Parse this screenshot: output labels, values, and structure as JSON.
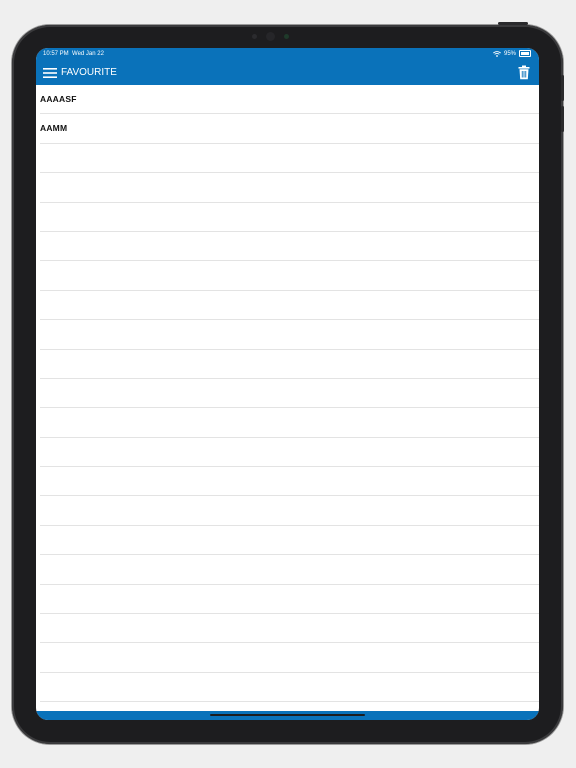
{
  "status_bar": {
    "time": "10:57 PM",
    "date": "Wed Jan 22",
    "wifi_icon": "wifi-icon",
    "battery_percent": "95%",
    "battery_level": 0.95
  },
  "nav": {
    "menu_icon": "hamburger-menu-icon",
    "title": "FAVOURITE",
    "delete_icon": "trash-icon"
  },
  "favourites": [
    {
      "label": "AAAASF"
    },
    {
      "label": "AAMM"
    },
    {
      "label": ""
    },
    {
      "label": ""
    },
    {
      "label": ""
    },
    {
      "label": ""
    },
    {
      "label": ""
    },
    {
      "label": ""
    },
    {
      "label": ""
    },
    {
      "label": ""
    },
    {
      "label": ""
    },
    {
      "label": ""
    },
    {
      "label": ""
    },
    {
      "label": ""
    },
    {
      "label": ""
    },
    {
      "label": ""
    },
    {
      "label": ""
    },
    {
      "label": ""
    },
    {
      "label": ""
    },
    {
      "label": ""
    },
    {
      "label": ""
    },
    {
      "label": ""
    }
  ],
  "colors": {
    "accent": "#0a72ba",
    "background": "#ffffff",
    "divider": "#e3e3e3"
  }
}
